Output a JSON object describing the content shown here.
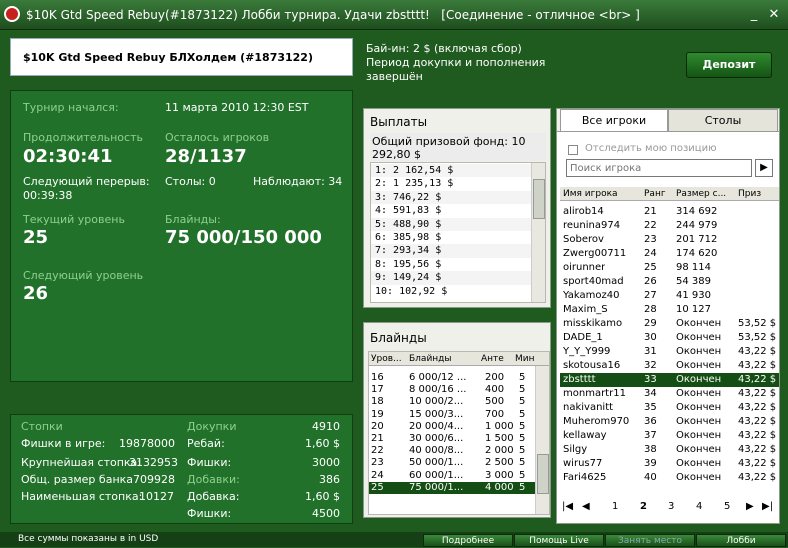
{
  "window": {
    "title": "$10K Gtd Speed Rebuy(#1873122) Лобби турнира. Удачи zbstttt!",
    "connection": "[Соединение - отличное <br> ]"
  },
  "header": {
    "tournament_name": "$10K Gtd Speed Rebuy БЛХолдем (#1873122)",
    "buyin_line1": "Бай-ин: 2 $ (включая сбор)",
    "buyin_line2": "Период докупки и пополнения",
    "buyin_line3": "завершён",
    "deposit_label": "Депозит"
  },
  "info": {
    "started_label": "Турнир начался:",
    "started_value": "11 марта 2010  12:30 EST",
    "duration_label": "Продолжительность",
    "duration_value": "02:30:41",
    "remaining_label": "Осталось игроков",
    "remaining_value": "28/1137",
    "next_break_label": "Следующий перерыв:",
    "next_break_value": "00:39:38",
    "tables_label": "Столы: 0",
    "observers_label": "Наблюдают: 34",
    "level_label": "Текущий уровень",
    "level_value": "25",
    "blinds_label": "Блайнды:",
    "blinds_value": "75 000/150 000",
    "next_level_label": "Следующий уровень",
    "next_level_value": "26"
  },
  "stats": {
    "stacks_label": "Стопки",
    "chips_in_game_label": "Фишки в игре:",
    "chips_in_game_value": "19878000",
    "largest_label": "Крупнейшая стопка:",
    "largest_value": "3132953",
    "bank_label": "Общ. размер банка",
    "bank_value": "709928",
    "smallest_label": "Наименьшая стопка:",
    "smallest_value": "10127",
    "rebuys_label": "Докупки",
    "rebuys_value": "4910",
    "rebuy_label": "Ребай:",
    "rebuy_value": "1,60 $",
    "chips_label": "Фишки:",
    "chips_value": "3000",
    "addons_label": "Добавки:",
    "addons_value": "386",
    "addon_label": "Добавка:",
    "addon_value": "1,60 $",
    "chips2_label": "Фишки:",
    "chips2_value": "4500"
  },
  "payouts": {
    "title": "Выплаты",
    "pool_label": "Общий призовой фонд: 10 292,80 $",
    "rows": [
      "1: 2 162,54 $",
      "2: 1 235,13 $",
      "3: 746,22 $",
      "4: 591,83 $",
      "5: 488,90 $",
      "6: 385,98 $",
      "7: 293,34 $",
      "8: 195,56 $",
      "9: 149,24 $",
      "10: 102,92 $"
    ]
  },
  "blinds_table": {
    "title": "Блайнды",
    "headers": [
      "Уров...",
      "Блайнды",
      "Анте",
      "Мин"
    ],
    "rows": [
      [
        "16",
        "6 000/12 ...",
        "200",
        "5"
      ],
      [
        "17",
        "8 000/16 ...",
        "400",
        "5"
      ],
      [
        "18",
        "10 000/2...",
        "500",
        "5"
      ],
      [
        "19",
        "15 000/3...",
        "700",
        "5"
      ],
      [
        "20",
        "20 000/4...",
        "1 000",
        "5"
      ],
      [
        "21",
        "30 000/6...",
        "1 500",
        "5"
      ],
      [
        "22",
        "40 000/8...",
        "2 000",
        "5"
      ],
      [
        "23",
        "50 000/1...",
        "2 500",
        "5"
      ],
      [
        "24",
        "60 000/1...",
        "3 000",
        "5"
      ],
      [
        "25",
        "75 000/1...",
        "4 000",
        "5"
      ]
    ]
  },
  "players": {
    "tab_all": "Все игроки",
    "tab_tables": "Столы",
    "track_label": "Отследить мою позицию",
    "search_placeholder": "Поиск игрока",
    "headers": [
      "Имя игрока",
      "Ранг",
      "Размер с...",
      "Приз"
    ],
    "rows": [
      [
        "alirob14",
        "21",
        "314 692",
        ""
      ],
      [
        "reunina974",
        "22",
        "244 979",
        ""
      ],
      [
        "Soberov",
        "23",
        "201 712",
        ""
      ],
      [
        "Zwerg00711",
        "24",
        "174 620",
        ""
      ],
      [
        "oirunner",
        "25",
        "98 114",
        ""
      ],
      [
        "sport40mad",
        "26",
        "54 389",
        ""
      ],
      [
        "Yakamoz40",
        "27",
        "41 930",
        ""
      ],
      [
        "Maxim_S",
        "28",
        "10 127",
        ""
      ],
      [
        "misskikamo",
        "29",
        "Окончен",
        "53,52 $"
      ],
      [
        "DADE_1",
        "30",
        "Окончен",
        "53,52 $"
      ],
      [
        "Y_Y_Y999",
        "31",
        "Окончен",
        "43,22 $"
      ],
      [
        "skotousa16",
        "32",
        "Окончен",
        "43,22 $"
      ],
      [
        "zbstttt",
        "33",
        "Окончен",
        "43,22 $"
      ],
      [
        "monmartr11",
        "34",
        "Окончен",
        "43,22 $"
      ],
      [
        "nakivanitt",
        "35",
        "Окончен",
        "43,22 $"
      ],
      [
        "Muherom970",
        "36",
        "Окончен",
        "43,22 $"
      ],
      [
        "kellaway",
        "37",
        "Окончен",
        "43,22 $"
      ],
      [
        "Silgy",
        "38",
        "Окончен",
        "43,22 $"
      ],
      [
        "wirus77",
        "39",
        "Окончен",
        "43,22 $"
      ],
      [
        "Fari4625",
        "40",
        "Окончен",
        "43,22 $"
      ]
    ],
    "pages": [
      "1",
      "2",
      "3",
      "4",
      "5"
    ]
  },
  "footer": {
    "note": "Все суммы показаны в in USD",
    "more_label": "Подробнее",
    "help_label": "Помощь Live",
    "seat_label": "Занять место",
    "lobby_label": "Лобби"
  },
  "colors": {
    "panel": "#22712a",
    "accent_label": "#8fd08f",
    "selected_row": "#144e14"
  }
}
